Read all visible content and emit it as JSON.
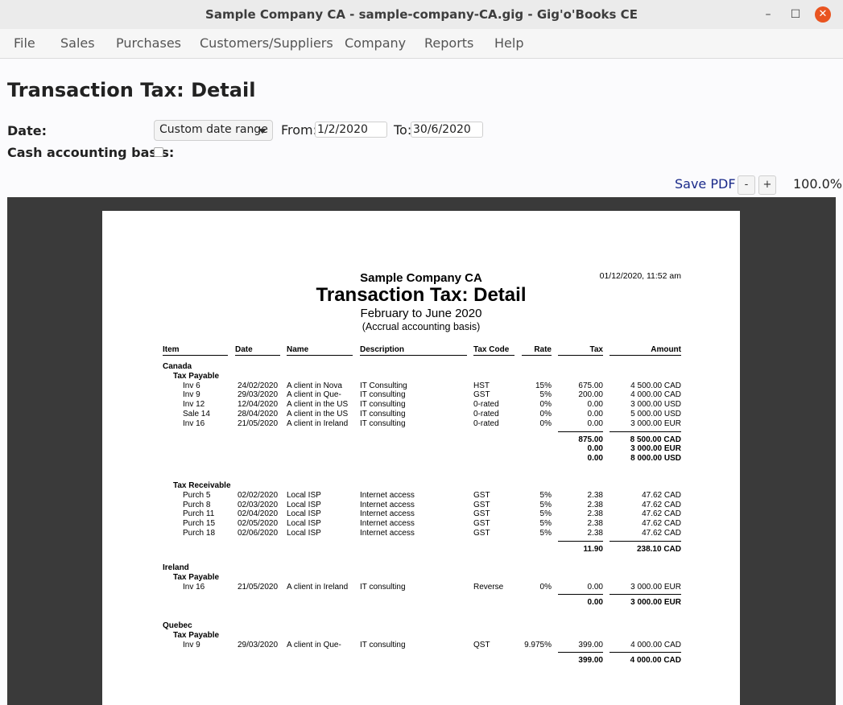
{
  "window": {
    "title": "Sample Company CA - sample-company-CA.gig - Gig'o'Books CE",
    "min_glyph": "–",
    "max_glyph": "☐",
    "close_glyph": "✕"
  },
  "menu": [
    "File",
    "Sales",
    "Purchases",
    "Customers/Suppliers",
    "Company",
    "Reports",
    "Help"
  ],
  "page": {
    "title": "Transaction Tax: Detail",
    "date_label": "Date:",
    "date_range": "Custom date range",
    "from_label": "From:",
    "from_value": "1/2/2020",
    "to_label": "To:",
    "to_value": "30/6/2020",
    "cash_label": "Cash accounting basis:",
    "cash_checked": false,
    "save_pdf": "Save PDF",
    "zoom_out": "-",
    "zoom_in": "+",
    "zoom": "100.0%"
  },
  "report": {
    "company": "Sample Company CA",
    "title": "Transaction Tax: Detail",
    "period": "February to June 2020",
    "basis": "(Accrual accounting basis)",
    "timestamp": "01/12/2020, 11:52 am",
    "columns": {
      "item": "Item",
      "date": "Date",
      "name": "Name",
      "description": "Description",
      "tax_code": "Tax Code",
      "rate": "Rate",
      "tax": "Tax",
      "amount": "Amount"
    },
    "sections": [
      {
        "region": "Canada",
        "groups": [
          {
            "name": "Tax Payable",
            "rows": [
              {
                "item": "Inv 6",
                "date": "24/02/2020",
                "name": "A client in Nova",
                "description": "IT Consulting",
                "code": "HST",
                "rate": "15%",
                "tax": "675.00",
                "amount": "4 500.00 CAD"
              },
              {
                "item": "Inv 9",
                "date": "29/03/2020",
                "name": "A client in Que-",
                "description": "IT consulting",
                "code": "GST",
                "rate": "5%",
                "tax": "200.00",
                "amount": "4 000.00 CAD"
              },
              {
                "item": "Inv 12",
                "date": "12/04/2020",
                "name": "A client in the US",
                "description": "IT consulting",
                "code": "0-rated",
                "rate": "0%",
                "tax": "0.00",
                "amount": "3 000.00 USD"
              },
              {
                "item": "Sale 14",
                "date": "28/04/2020",
                "name": "A client in the US",
                "description": "IT consulting",
                "code": "0-rated",
                "rate": "0%",
                "tax": "0.00",
                "amount": "5 000.00 USD"
              },
              {
                "item": "Inv 16",
                "date": "21/05/2020",
                "name": "A client in Ireland",
                "description": "IT consulting",
                "code": "0-rated",
                "rate": "0%",
                "tax": "0.00",
                "amount": "3 000.00 EUR"
              }
            ],
            "totals": [
              {
                "tax": "875.00",
                "amount": "8 500.00 CAD"
              },
              {
                "tax": "0.00",
                "amount": "3 000.00 EUR"
              },
              {
                "tax": "0.00",
                "amount": "8 000.00 USD"
              }
            ]
          },
          {
            "name": "Tax Receivable",
            "rows": [
              {
                "item": "Purch 5",
                "date": "02/02/2020",
                "name": "Local ISP",
                "description": "Internet access",
                "code": "GST",
                "rate": "5%",
                "tax": "2.38",
                "amount": "47.62 CAD"
              },
              {
                "item": "Purch 8",
                "date": "02/03/2020",
                "name": "Local ISP",
                "description": "Internet access",
                "code": "GST",
                "rate": "5%",
                "tax": "2.38",
                "amount": "47.62 CAD"
              },
              {
                "item": "Purch 11",
                "date": "02/04/2020",
                "name": "Local ISP",
                "description": "Internet access",
                "code": "GST",
                "rate": "5%",
                "tax": "2.38",
                "amount": "47.62 CAD"
              },
              {
                "item": "Purch 15",
                "date": "02/05/2020",
                "name": "Local ISP",
                "description": "Internet access",
                "code": "GST",
                "rate": "5%",
                "tax": "2.38",
                "amount": "47.62 CAD"
              },
              {
                "item": "Purch 18",
                "date": "02/06/2020",
                "name": "Local ISP",
                "description": "Internet access",
                "code": "GST",
                "rate": "5%",
                "tax": "2.38",
                "amount": "47.62 CAD"
              }
            ],
            "totals": [
              {
                "tax": "11.90",
                "amount": "238.10 CAD"
              }
            ]
          }
        ]
      },
      {
        "region": "Ireland",
        "groups": [
          {
            "name": "Tax Payable",
            "rows": [
              {
                "item": "Inv 16",
                "date": "21/05/2020",
                "name": "A client in Ireland",
                "description": "IT consulting",
                "code": "Reverse",
                "rate": "0%",
                "tax": "0.00",
                "amount": "3 000.00 EUR"
              }
            ],
            "totals": [
              {
                "tax": "0.00",
                "amount": "3 000.00 EUR"
              }
            ]
          }
        ]
      },
      {
        "region": "Quebec",
        "groups": [
          {
            "name": "Tax Payable",
            "rows": [
              {
                "item": "Inv 9",
                "date": "29/03/2020",
                "name": "A client in Que-",
                "description": "IT consulting",
                "code": "QST",
                "rate": "9.975%",
                "tax": "399.00",
                "amount": "4 000.00 CAD"
              }
            ],
            "totals": [
              {
                "tax": "399.00",
                "amount": "4 000.00 CAD"
              }
            ]
          }
        ]
      }
    ]
  }
}
